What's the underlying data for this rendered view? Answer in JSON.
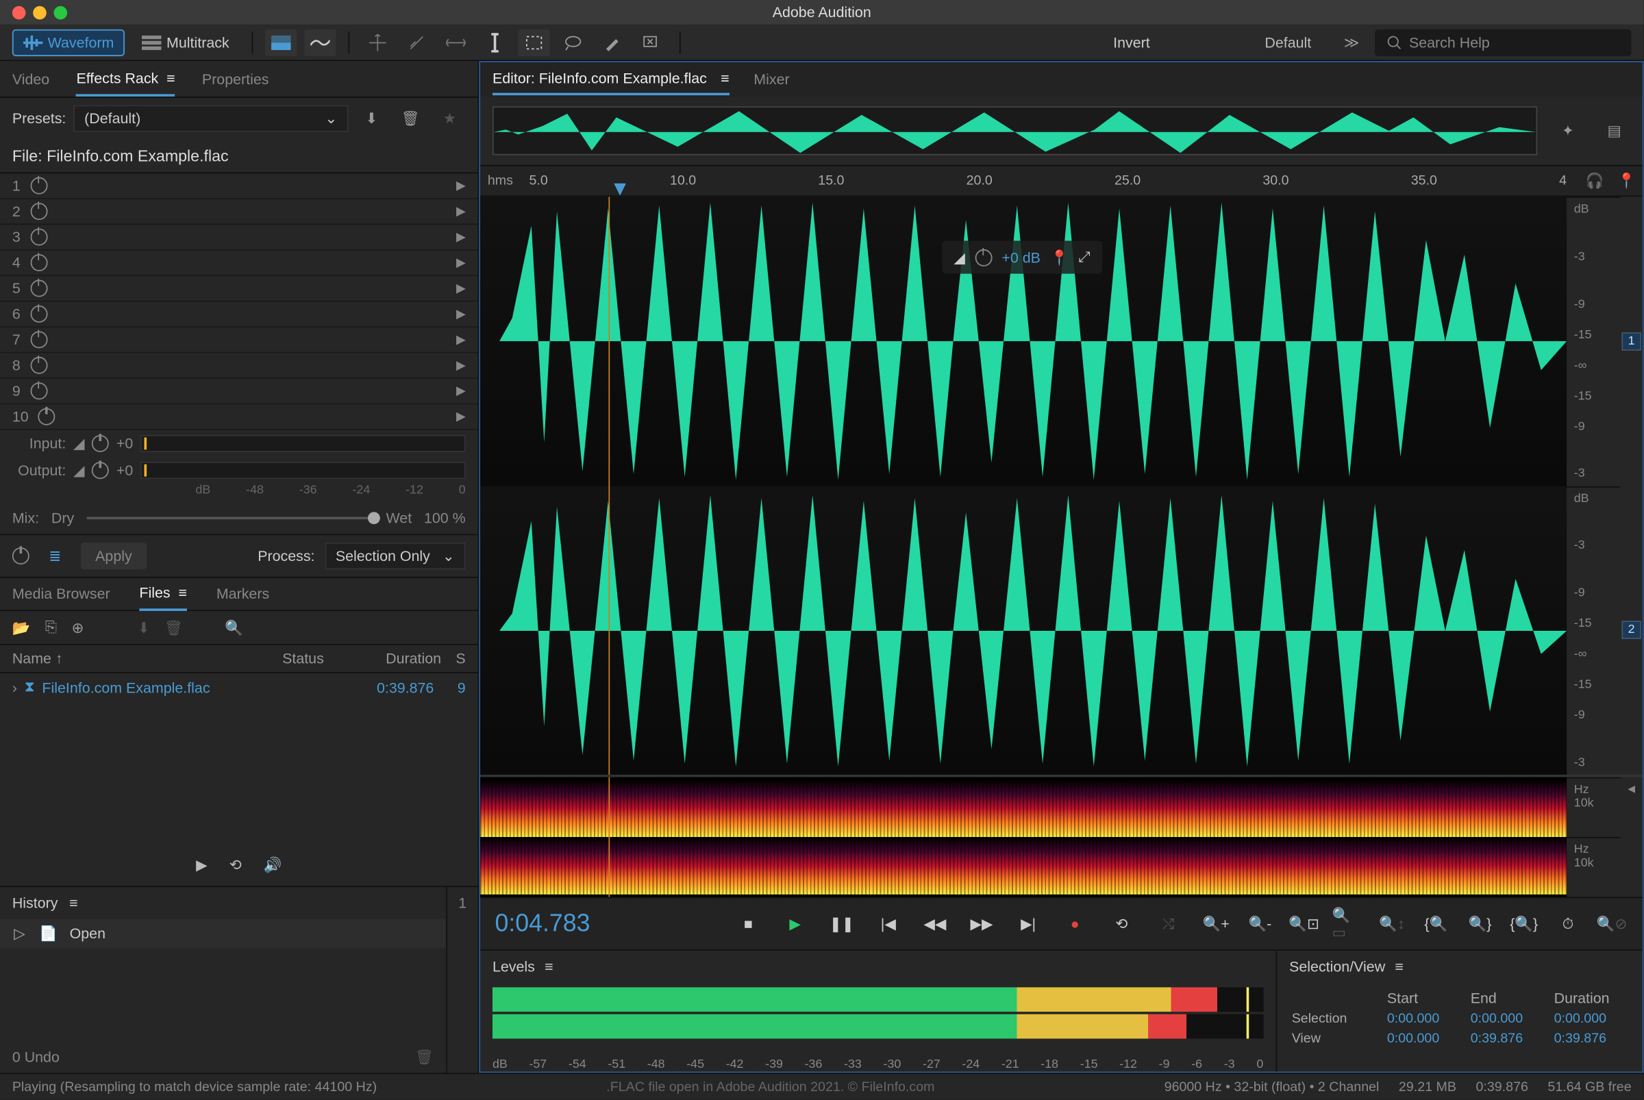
{
  "title": "Adobe Audition",
  "modes": {
    "waveform": "Waveform",
    "multitrack": "Multitrack"
  },
  "topbar": {
    "invert": "Invert",
    "workspace": "Default",
    "searchPlaceholder": "Search Help"
  },
  "leftTabs": {
    "video": "Video",
    "fx": "Effects Rack",
    "props": "Properties"
  },
  "presets": {
    "label": "Presets:",
    "value": "(Default)"
  },
  "fileLabel": "File: FileInfo.com Example.flac",
  "slots": [
    "1",
    "2",
    "3",
    "4",
    "5",
    "6",
    "7",
    "8",
    "9",
    "10"
  ],
  "io": {
    "input": "Input:",
    "output": "Output:",
    "zero": "+0"
  },
  "dbTicks": [
    "dB",
    "-48",
    "-36",
    "-24",
    "-12",
    "0"
  ],
  "mix": {
    "label": "Mix:",
    "dry": "Dry",
    "wet": "Wet",
    "pct": "100 %"
  },
  "apply": {
    "label": "Apply",
    "process": "Process:",
    "mode": "Selection Only"
  },
  "midTabs": {
    "media": "Media Browser",
    "files": "Files",
    "markers": "Markers"
  },
  "filesHdr": {
    "name": "Name",
    "status": "Status",
    "duration": "Duration",
    "s": "S"
  },
  "fileItem": {
    "name": "FileInfo.com Example.flac",
    "dur": "0:39.876",
    "s": "9"
  },
  "history": {
    "label": "History",
    "open": "Open",
    "undo": "0 Undo",
    "side": "1"
  },
  "editorTabs": {
    "editor": "Editor: FileInfo.com Example.flac",
    "mixer": "Mixer"
  },
  "timeline": {
    "unit": "hms",
    "ticks": [
      "5.0",
      "10.0",
      "15.0",
      "20.0",
      "25.0",
      "30.0",
      "35.0",
      "4"
    ]
  },
  "hud": {
    "db": "+0 dB"
  },
  "dbScale": {
    "label": "dB",
    "vals": [
      "-3",
      "-9",
      "-15",
      "-∞",
      "-15",
      "-9",
      "-3"
    ]
  },
  "hz": {
    "label": "Hz",
    "val": "10k"
  },
  "ch": {
    "one": "1",
    "two": "2"
  },
  "timecode": "0:04.783",
  "levels": {
    "label": "Levels",
    "scale": [
      "dB",
      "-57",
      "-54",
      "-51",
      "-48",
      "-45",
      "-42",
      "-39",
      "-36",
      "-33",
      "-30",
      "-27",
      "-24",
      "-21",
      "-18",
      "-15",
      "-12",
      "-9",
      "-6",
      "-3",
      "0"
    ]
  },
  "selView": {
    "label": "Selection/View",
    "start": "Start",
    "end": "End",
    "dur": "Duration",
    "sel": "Selection",
    "view": "View",
    "selStart": "0:00.000",
    "selEnd": "0:00.000",
    "selDur": "0:00.000",
    "viewStart": "0:00.000",
    "viewEnd": "0:39.876",
    "viewDur": "0:39.876"
  },
  "status": {
    "playing": "Playing (Resampling to match device sample rate: 44100 Hz)",
    "center": ".FLAC file open in Adobe Audition 2021. © FileInfo.com",
    "fmt": "96000 Hz • 32-bit (float) • 2 Channel",
    "size": "29.21 MB",
    "dur": "0:39.876",
    "free": "51.64 GB free"
  }
}
